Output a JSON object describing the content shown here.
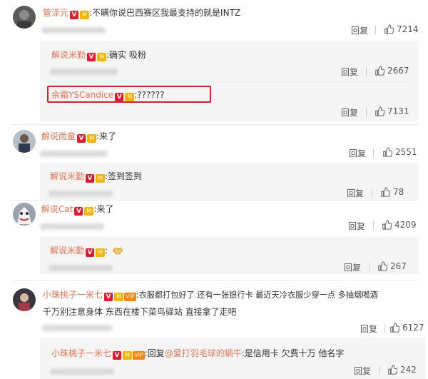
{
  "reply_label": "回复",
  "badges": {
    "v": "V",
    "m": "M",
    "vip": "VIP"
  },
  "comments": [
    {
      "author": "管泽元",
      "text": ":不瞒你说巴西赛区我最支持的就是INTZ",
      "likes": "7214",
      "replies": [
        {
          "author": "解说米勤",
          "text": ":确实 吸粉",
          "likes": "2667"
        },
        {
          "author": "余霜YSCandice",
          "text": ":??????",
          "likes": "7131"
        }
      ]
    },
    {
      "author": "解说雨童",
      "text": ":来了",
      "likes": "2551",
      "replies": [
        {
          "author": "解说米勤",
          "text": ":签到签到",
          "likes": "78"
        }
      ]
    },
    {
      "author": "解说Cat",
      "text": ":来了",
      "likes": "4209",
      "replies": [
        {
          "author": "解说米勤",
          "text": ":",
          "likes": "267"
        }
      ]
    },
    {
      "author": "小珠桃子一米七",
      "text_line1": ":衣服都打包好了 还有一张银行卡 最近天冷衣服少穿一点 多抽烟喝酒",
      "text_line2": "千万别注意身体 东西在楼下菜鸟驿站 直接拿了走吧",
      "likes": "6127",
      "replies": [
        {
          "author": "小珠桃子一米七",
          "text_prefix": ":回复",
          "mention": "@爱打羽毛球的蜗牛",
          "text": ":是信用卡 欠费十万 他名字",
          "likes": "242"
        }
      ]
    }
  ]
}
